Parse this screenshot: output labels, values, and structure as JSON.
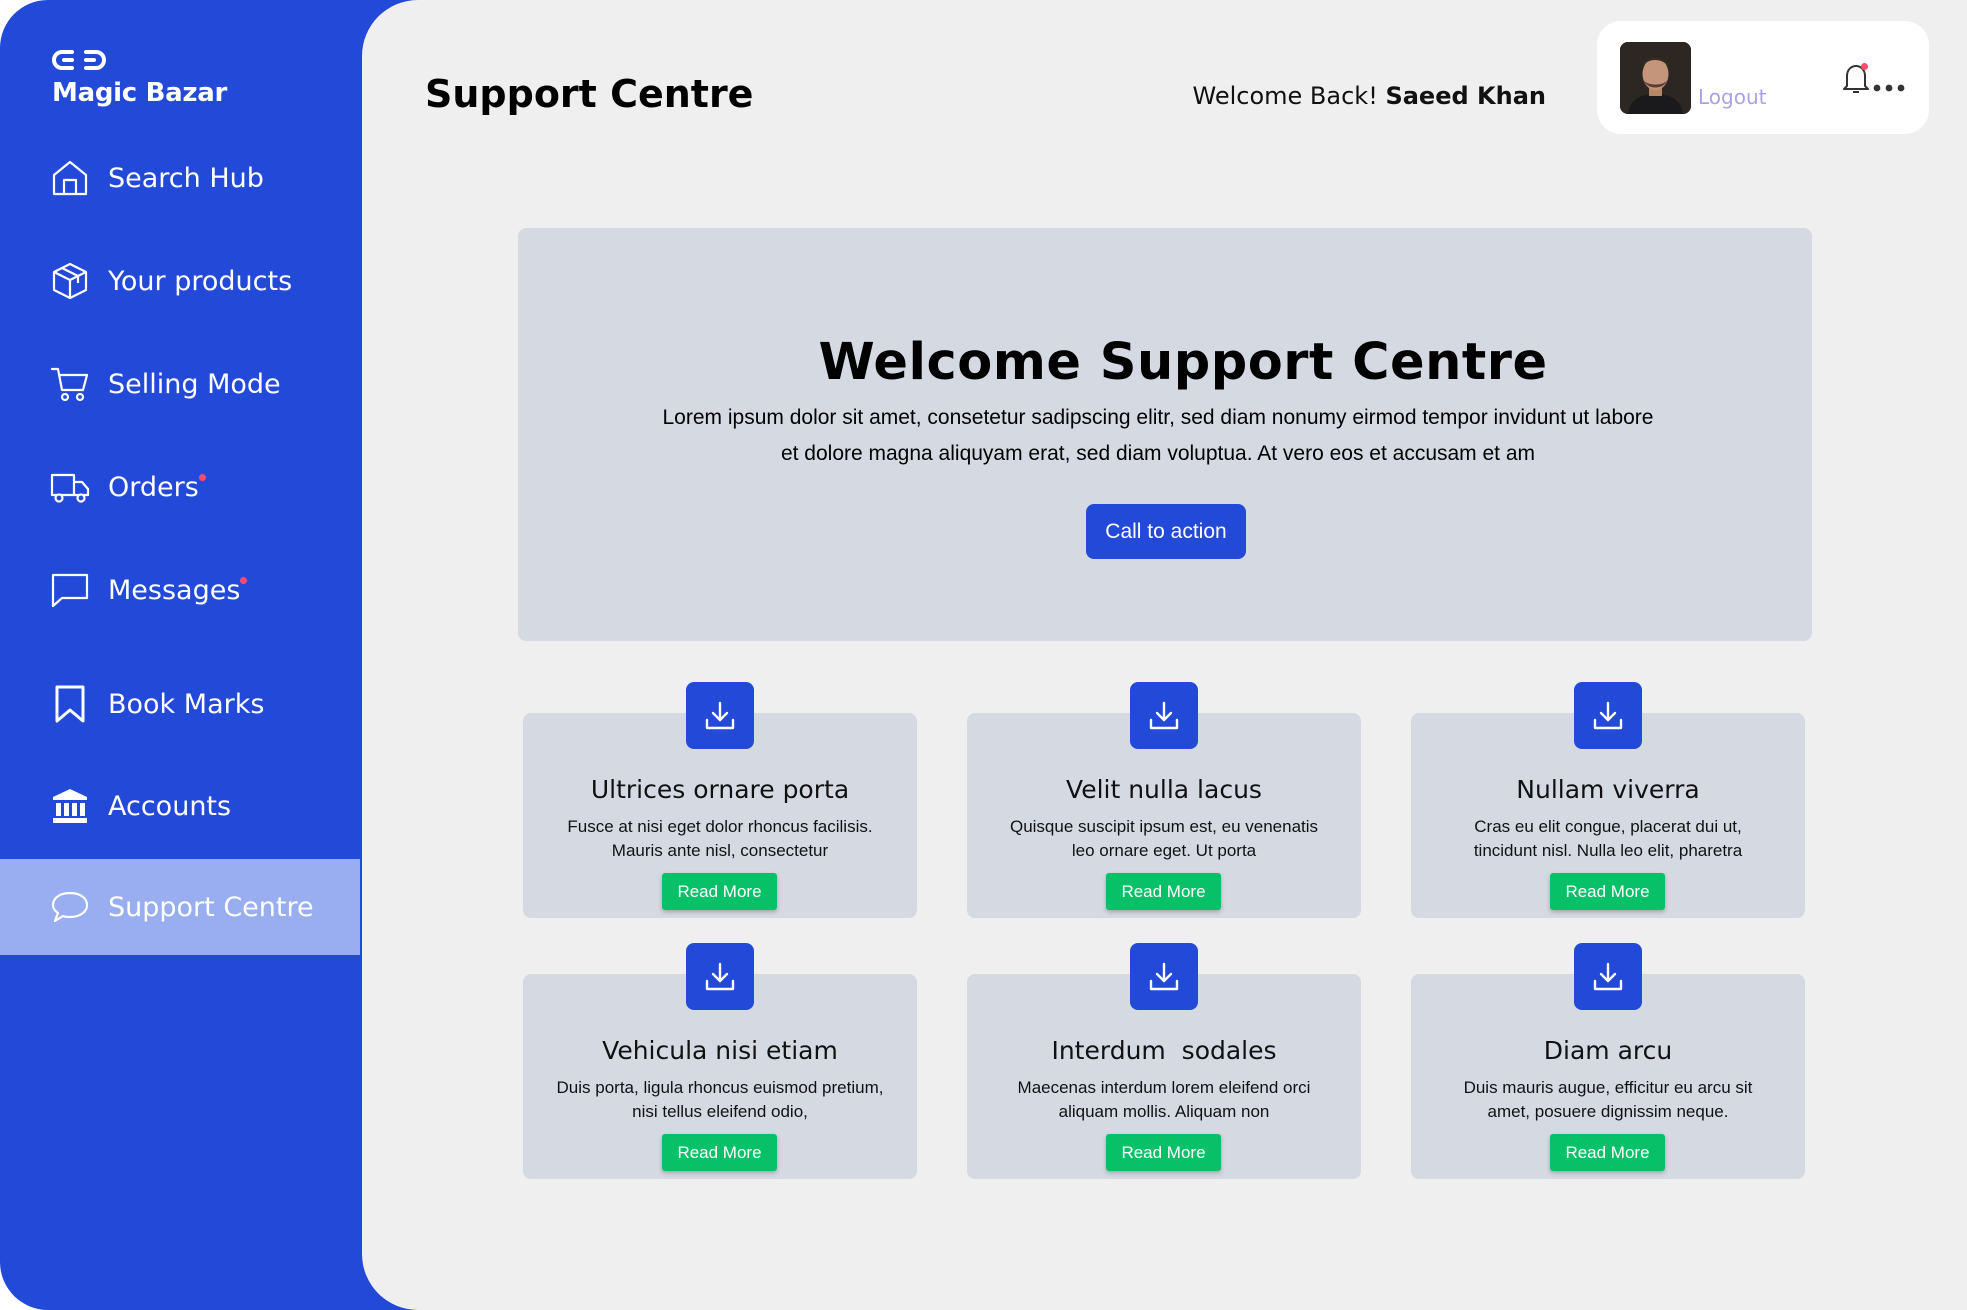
{
  "brand": {
    "name": "Magic Bazar",
    "logo_icon": "link-logo-icon",
    "primary_color": "#2249d8",
    "accent_color": "#06c167"
  },
  "sidebar": {
    "items": [
      {
        "label": "Search Hub",
        "icon": "home-icon"
      },
      {
        "label": "Your products",
        "icon": "box-icon"
      },
      {
        "label": "Selling Mode",
        "icon": "cart-icon"
      },
      {
        "label": "Orders",
        "icon": "truck-icon"
      },
      {
        "label": "Messages",
        "icon": "message-icon"
      },
      {
        "label": "Book Marks",
        "icon": "bookmark-icon"
      },
      {
        "label": "Accounts",
        "icon": "bank-icon"
      },
      {
        "label": "Support Centre",
        "icon": "chat-icon"
      }
    ],
    "active": "Support Centre"
  },
  "header": {
    "title": "Support Centre",
    "welcome_prefix": "Welcome Back!",
    "user_name": "Saeed Khan",
    "logout_label": "Logout"
  },
  "hero": {
    "title": "Welcome Support Centre",
    "text": "Lorem ipsum dolor sit amet, consetetur sadipscing elitr, sed diam nonumy eirmod tempor invidunt ut labore et dolore magna aliquyam erat, sed diam voluptua. At vero eos et accusam et am",
    "cta_label": "Call to action"
  },
  "cards": [
    {
      "title": "Ultrices ornare porta",
      "text": "Fusce at nisi eget dolor rhoncus facilisis. Mauris ante nisl, consectetur",
      "button": "Read More"
    },
    {
      "title": "Velit nulla lacus",
      "text": "Quisque suscipit ipsum est, eu venenatis leo ornare eget. Ut porta",
      "button": "Read More"
    },
    {
      "title": "Nullam viverra",
      "text": "Cras eu elit congue, placerat dui ut, tincidunt nisl. Nulla leo elit, pharetra",
      "button": "Read More"
    },
    {
      "title": "Vehicula nisi etiam",
      "text": "Duis porta, ligula rhoncus euismod pretium, nisi tellus eleifend odio,",
      "button": "Read More"
    },
    {
      "title": "Interdum  sodales",
      "text": "Maecenas interdum lorem eleifend orci aliquam mollis. Aliquam non",
      "button": "Read More"
    },
    {
      "title": "Diam arcu",
      "text": "Duis mauris augue, efficitur eu arcu sit amet, posuere dignissim neque.",
      "button": "Read More"
    }
  ]
}
